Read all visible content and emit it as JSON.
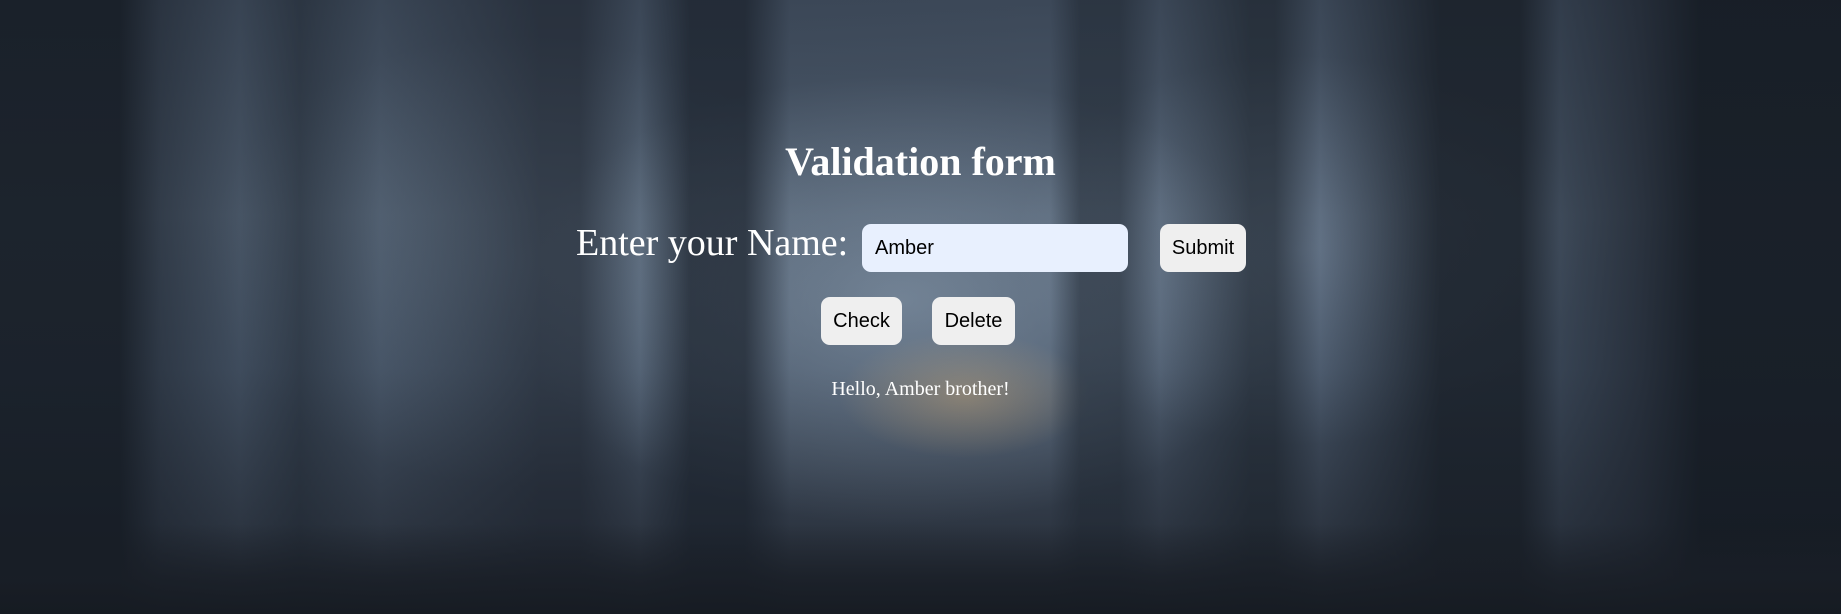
{
  "page": {
    "title": "Validation form"
  },
  "form": {
    "name_label": "Enter your Name:",
    "name_value": "Amber",
    "submit_label": "Submit",
    "check_label": "Check",
    "delete_label": "Delete"
  },
  "output": {
    "message": "Hello, Amber brother!"
  },
  "colors": {
    "text": "#ffffff",
    "input_background": "#e8f0fe",
    "button_background": "#efefef"
  }
}
